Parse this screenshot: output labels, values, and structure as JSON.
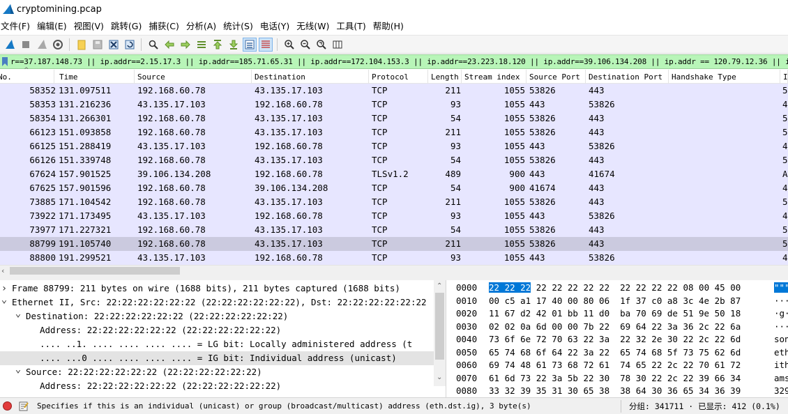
{
  "window": {
    "title": "cryptomining.pcap"
  },
  "menu": [
    "文件(F)",
    "编辑(E)",
    "视图(V)",
    "跳转(G)",
    "捕获(C)",
    "分析(A)",
    "统计(S)",
    "电话(Y)",
    "无线(W)",
    "工具(T)",
    "帮助(H)"
  ],
  "toolbar": {
    "icons": [
      "start-capture-icon",
      "stop-capture-icon",
      "restart-capture-icon",
      "capture-options-icon",
      "open-file-icon",
      "save-file-icon",
      "close-file-icon",
      "reload-file-icon",
      "find-packet-icon",
      "go-back-icon",
      "go-forward-icon",
      "go-to-packet-icon",
      "go-first-packet-icon",
      "go-last-packet-icon",
      "auto-scroll-icon",
      "colorize-icon",
      "zoom-in-icon",
      "zoom-out-icon",
      "zoom-normal-icon",
      "resize-columns-icon"
    ],
    "active": [
      "auto-scroll-icon",
      "colorize-icon"
    ]
  },
  "filter": {
    "text": "r==37.187.148.73 || ip.addr==2.15.17.3 || ip.addr==185.71.65.31 || ip.addr==172.104.153.3 || ip.addr==23.223.18.120 || ip.addr==39.106.134.208 || ip.addr == 120.79.12.36 || ip.addr == 12"
  },
  "packet_list": {
    "columns": [
      "No.",
      "Time",
      "Source",
      "Destination",
      "Protocol",
      "Length",
      "Stream index",
      "Source Port",
      "Destination Port",
      "Handshake Type",
      "I"
    ],
    "rows": [
      {
        "no": "58352",
        "time": "131.097511",
        "src": "192.168.60.78",
        "dst": "43.135.17.103",
        "proto": "TCP",
        "len": "211",
        "stream": "1055",
        "sport": "53826",
        "dport": "443",
        "hs": "",
        "info": "5"
      },
      {
        "no": "58353",
        "time": "131.216236",
        "src": "43.135.17.103",
        "dst": "192.168.60.78",
        "proto": "TCP",
        "len": "93",
        "stream": "1055",
        "sport": "443",
        "dport": "53826",
        "hs": "",
        "info": "4"
      },
      {
        "no": "58354",
        "time": "131.266301",
        "src": "192.168.60.78",
        "dst": "43.135.17.103",
        "proto": "TCP",
        "len": "54",
        "stream": "1055",
        "sport": "53826",
        "dport": "443",
        "hs": "",
        "info": "5"
      },
      {
        "no": "66123",
        "time": "151.093858",
        "src": "192.168.60.78",
        "dst": "43.135.17.103",
        "proto": "TCP",
        "len": "211",
        "stream": "1055",
        "sport": "53826",
        "dport": "443",
        "hs": "",
        "info": "5"
      },
      {
        "no": "66125",
        "time": "151.288419",
        "src": "43.135.17.103",
        "dst": "192.168.60.78",
        "proto": "TCP",
        "len": "93",
        "stream": "1055",
        "sport": "443",
        "dport": "53826",
        "hs": "",
        "info": "4"
      },
      {
        "no": "66126",
        "time": "151.339748",
        "src": "192.168.60.78",
        "dst": "43.135.17.103",
        "proto": "TCP",
        "len": "54",
        "stream": "1055",
        "sport": "53826",
        "dport": "443",
        "hs": "",
        "info": "5"
      },
      {
        "no": "67624",
        "time": "157.901525",
        "src": "39.106.134.208",
        "dst": "192.168.60.78",
        "proto": "TLSv1.2",
        "len": "489",
        "stream": "900",
        "sport": "443",
        "dport": "41674",
        "hs": "",
        "info": "A"
      },
      {
        "no": "67625",
        "time": "157.901596",
        "src": "192.168.60.78",
        "dst": "39.106.134.208",
        "proto": "TCP",
        "len": "54",
        "stream": "900",
        "sport": "41674",
        "dport": "443",
        "hs": "",
        "info": "4"
      },
      {
        "no": "73885",
        "time": "171.104542",
        "src": "192.168.60.78",
        "dst": "43.135.17.103",
        "proto": "TCP",
        "len": "211",
        "stream": "1055",
        "sport": "53826",
        "dport": "443",
        "hs": "",
        "info": "5"
      },
      {
        "no": "73922",
        "time": "171.173495",
        "src": "43.135.17.103",
        "dst": "192.168.60.78",
        "proto": "TCP",
        "len": "93",
        "stream": "1055",
        "sport": "443",
        "dport": "53826",
        "hs": "",
        "info": "4"
      },
      {
        "no": "73977",
        "time": "171.227321",
        "src": "192.168.60.78",
        "dst": "43.135.17.103",
        "proto": "TCP",
        "len": "54",
        "stream": "1055",
        "sport": "53826",
        "dport": "443",
        "hs": "",
        "info": "5"
      },
      {
        "no": "88799",
        "time": "191.105740",
        "src": "192.168.60.78",
        "dst": "43.135.17.103",
        "proto": "TCP",
        "len": "211",
        "stream": "1055",
        "sport": "53826",
        "dport": "443",
        "hs": "",
        "info": "5",
        "selected": true
      },
      {
        "no": "88800",
        "time": "191.299521",
        "src": "43.135.17.103",
        "dst": "192.168.60.78",
        "proto": "TCP",
        "len": "93",
        "stream": "1055",
        "sport": "443",
        "dport": "53826",
        "hs": "",
        "info": "4"
      }
    ]
  },
  "details": [
    {
      "arrow": ">",
      "indent": 0,
      "text": "Frame 88799: 211 bytes on wire (1688 bits), 211 bytes captured (1688 bits)"
    },
    {
      "arrow": "v",
      "indent": 0,
      "text": "Ethernet II, Src: 22:22:22:22:22:22 (22:22:22:22:22:22), Dst: 22:22:22:22:22:22"
    },
    {
      "arrow": "v",
      "indent": 1,
      "text": "Destination: 22:22:22:22:22:22 (22:22:22:22:22:22)"
    },
    {
      "arrow": "",
      "indent": 2,
      "text": "Address: 22:22:22:22:22:22 (22:22:22:22:22:22)"
    },
    {
      "arrow": "",
      "indent": 2,
      "text": ".... ..1. .... .... .... .... = LG bit: Locally administered address (t"
    },
    {
      "arrow": "",
      "indent": 2,
      "text": ".... ...0 .... .... .... .... = IG bit: Individual address (unicast)",
      "selected": true
    },
    {
      "arrow": "v",
      "indent": 1,
      "text": "Source: 22:22:22:22:22:22 (22:22:22:22:22:22)"
    },
    {
      "arrow": "",
      "indent": 2,
      "text": "Address: 22:22:22:22:22:22 (22:22:22:22:22:22)"
    }
  ],
  "hex": [
    {
      "off": "0000",
      "sel": "22 22 22",
      "bytes": " 22 22 22 22 22  22 22 22 22 08 00 45 00",
      "ascii_sel": "\"\"\"",
      "ascii": ""
    },
    {
      "off": "0010",
      "sel": "",
      "bytes": "00 c5 a1 17 40 00 80 06  1f 37 c0 a8 3c 4e 2b 87",
      "ascii_sel": "",
      "ascii": "···"
    },
    {
      "off": "0020",
      "sel": "",
      "bytes": "11 67 d2 42 01 bb 11 d0  ba 70 69 de 51 9e 50 18",
      "ascii_sel": "",
      "ascii": "·g·"
    },
    {
      "off": "0030",
      "sel": "",
      "bytes": "02 02 0a 6d 00 00 7b 22  69 64 22 3a 36 2c 22 6a",
      "ascii_sel": "",
      "ascii": "···"
    },
    {
      "off": "0040",
      "sel": "",
      "bytes": "73 6f 6e 72 70 63 22 3a  22 32 2e 30 22 2c 22 6d",
      "ascii_sel": "",
      "ascii": "son"
    },
    {
      "off": "0050",
      "sel": "",
      "bytes": "65 74 68 6f 64 22 3a 22  65 74 68 5f 73 75 62 6d",
      "ascii_sel": "",
      "ascii": "eth"
    },
    {
      "off": "0060",
      "sel": "",
      "bytes": "69 74 48 61 73 68 72 61  74 65 22 2c 22 70 61 72",
      "ascii_sel": "",
      "ascii": "ith"
    },
    {
      "off": "0070",
      "sel": "",
      "bytes": "61 6d 73 22 3a 5b 22 30  78 30 22 2c 22 39 66 34",
      "ascii_sel": "",
      "ascii": "ams"
    },
    {
      "off": "0080",
      "sel": "",
      "bytes": "33 32 39 35 31 30 65 38  38 64 30 36 65 34 36 39",
      "ascii_sel": "",
      "ascii": "329"
    }
  ],
  "status": {
    "message": "Specifies if this is an individual (unicast) or group (broadcast/multicast) address (eth.dst.ig), 3 byte(s)",
    "stats": "分组: 341711 · 已显示: 412 (0.1%)"
  }
}
